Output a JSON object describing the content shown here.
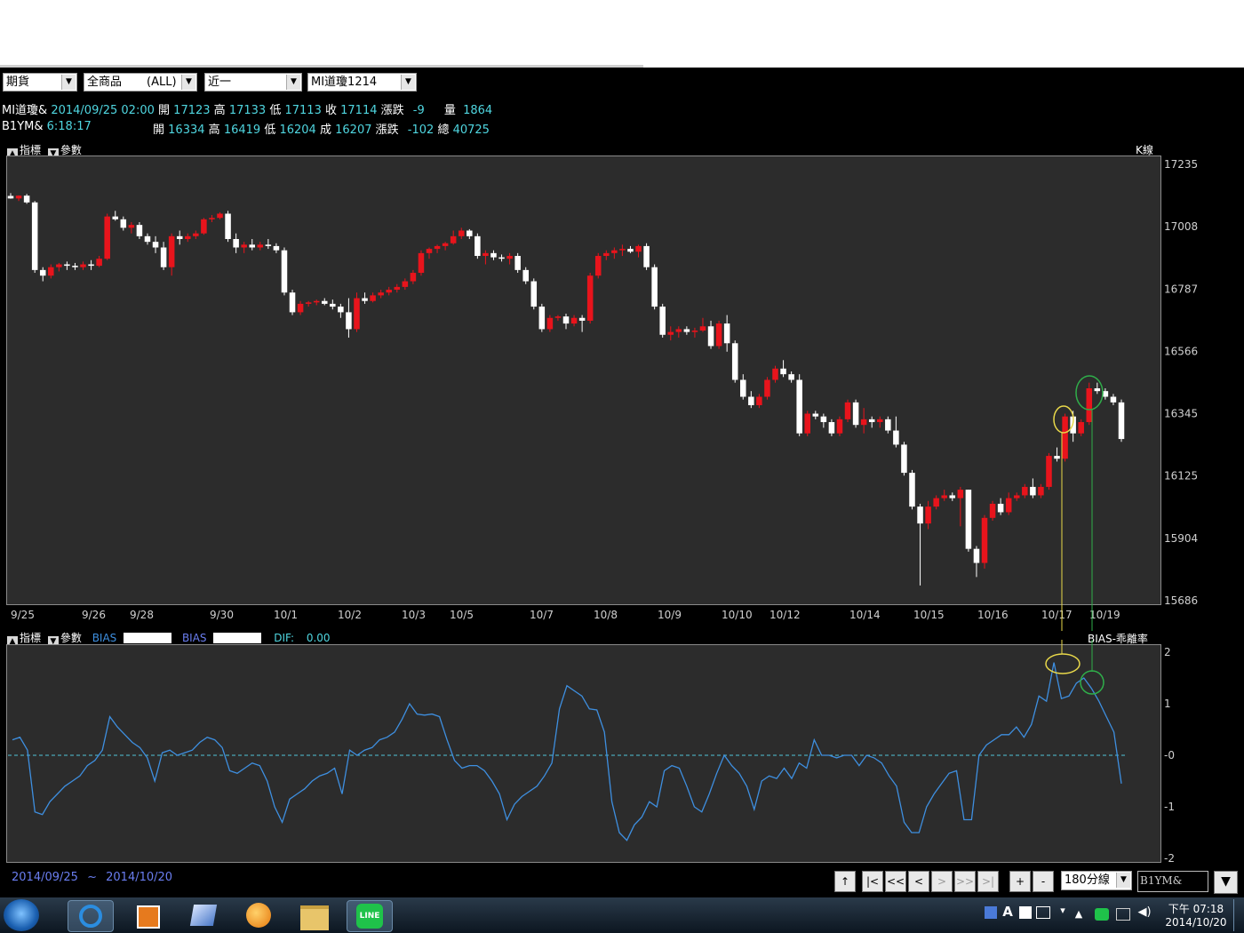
{
  "toolbar": {
    "market": "期貨",
    "products": "全商品",
    "products_filter": "(ALL)",
    "period": "近一",
    "symbol": "MI道瓊1214"
  },
  "quote1": {
    "name": "MI道瓊&",
    "datetime": "2014/09/25 02:00",
    "open_label": "開",
    "open": "17123",
    "high_label": "高",
    "high": "17133",
    "low_label": "低",
    "low": "17113",
    "close_label": "收",
    "close": "17114",
    "chg_label": "漲跌",
    "chg": "-9",
    "vol_label": "量",
    "vol": "1864"
  },
  "quote2": {
    "name": "B1YM&",
    "time": "6:18:17",
    "open_label": "開",
    "open": "16334",
    "high_label": "高",
    "high": "16419",
    "low_label": "低",
    "low": "16204",
    "last_label": "成",
    "last": "16207",
    "chg_label": "漲跌",
    "chg": "-102",
    "total_label": "總",
    "total": "40725"
  },
  "indicator_bar": {
    "indicator_label": "指標",
    "param_label": "參數",
    "main_label": "K線"
  },
  "lower_bar": {
    "indicator_label": "指標",
    "param_label": "參數",
    "bias1": "BIAS",
    "bias2": "BIAS",
    "dif_label": "DIF:",
    "dif_value": "0.00",
    "right_label": "BIAS-乖離率"
  },
  "date_range": {
    "from": "2014/09/25",
    "sep": "~",
    "to": "2014/10/20"
  },
  "nav": {
    "up": "↑",
    "first": "|<",
    "prev_fast": "<<",
    "prev": "<",
    "next": ">",
    "next_fast": ">>",
    "last": ">|",
    "zoom_in": "+",
    "zoom_out": "-",
    "interval": "180分線",
    "code": "B1YM&"
  },
  "clock": {
    "time": "下午 07:18",
    "date": "2014/10/20"
  },
  "chart_data": [
    {
      "type": "candlestick",
      "ylim": [
        15686,
        17235
      ],
      "y_ticks": [
        "17235",
        "17008",
        "16787",
        "16566",
        "16345",
        "16125",
        "15904",
        "15686"
      ],
      "x_labels": [
        "9/25",
        "9/26",
        "9/28",
        "9/30",
        "10/1",
        "10/2",
        "10/3",
        "10/5",
        "10/7",
        "10/8",
        "10/9",
        "10/10",
        "10/12",
        "10/14",
        "10/15",
        "10/16",
        "10/17",
        "10/19"
      ],
      "colors": {
        "up": "#e8141c",
        "down": "#ffffff"
      },
      "ohlc": [
        [
          17123,
          17133,
          17113,
          17114
        ],
        [
          17114,
          17125,
          17105,
          17124
        ],
        [
          17124,
          17130,
          17095,
          17100
        ],
        [
          17100,
          17105,
          16850,
          16860
        ],
        [
          16860,
          16870,
          16820,
          16840
        ],
        [
          16840,
          16880,
          16830,
          16870
        ],
        [
          16870,
          16885,
          16855,
          16880
        ],
        [
          16880,
          16890,
          16860,
          16875
        ],
        [
          16875,
          16885,
          16860,
          16870
        ],
        [
          16870,
          16890,
          16860,
          16880
        ],
        [
          16880,
          16895,
          16860,
          16875
        ],
        [
          16875,
          16910,
          16870,
          16900
        ],
        [
          16900,
          17060,
          16895,
          17050
        ],
        [
          17050,
          17070,
          17035,
          17040
        ],
        [
          17040,
          17050,
          17000,
          17010
        ],
        [
          17010,
          17030,
          16990,
          17020
        ],
        [
          17020,
          17030,
          16970,
          16980
        ],
        [
          16980,
          16990,
          16950,
          16960
        ],
        [
          16960,
          16980,
          16920,
          16940
        ],
        [
          16940,
          16960,
          16860,
          16870
        ],
        [
          16870,
          16990,
          16840,
          16980
        ],
        [
          16980,
          17000,
          16950,
          16970
        ],
        [
          16970,
          16990,
          16960,
          16980
        ],
        [
          16980,
          17000,
          16970,
          16990
        ],
        [
          16990,
          17045,
          16985,
          17040
        ],
        [
          17040,
          17055,
          17030,
          17045
        ],
        [
          17045,
          17065,
          17040,
          17060
        ],
        [
          17060,
          17070,
          16960,
          16970
        ],
        [
          16970,
          16990,
          16920,
          16940
        ],
        [
          16940,
          16960,
          16920,
          16950
        ],
        [
          16950,
          16970,
          16930,
          16940
        ],
        [
          16940,
          16960,
          16930,
          16950
        ],
        [
          16950,
          16970,
          16935,
          16945
        ],
        [
          16945,
          16955,
          16920,
          16930
        ],
        [
          16930,
          16940,
          16770,
          16780
        ],
        [
          16780,
          16790,
          16700,
          16710
        ],
        [
          16710,
          16750,
          16700,
          16740
        ],
        [
          16740,
          16750,
          16730,
          16745
        ],
        [
          16745,
          16755,
          16735,
          16750
        ],
        [
          16750,
          16760,
          16735,
          16740
        ],
        [
          16740,
          16755,
          16720,
          16730
        ],
        [
          16730,
          16740,
          16690,
          16710
        ],
        [
          16710,
          16760,
          16620,
          16650
        ],
        [
          16650,
          16780,
          16640,
          16760
        ],
        [
          16760,
          16780,
          16740,
          16750
        ],
        [
          16750,
          16780,
          16745,
          16770
        ],
        [
          16770,
          16790,
          16760,
          16780
        ],
        [
          16780,
          16800,
          16770,
          16790
        ],
        [
          16790,
          16810,
          16780,
          16800
        ],
        [
          16800,
          16830,
          16790,
          16820
        ],
        [
          16820,
          16860,
          16810,
          16850
        ],
        [
          16850,
          16930,
          16840,
          16920
        ],
        [
          16920,
          16940,
          16900,
          16935
        ],
        [
          16935,
          16950,
          16920,
          16945
        ],
        [
          16945,
          16960,
          16930,
          16955
        ],
        [
          16955,
          17000,
          16950,
          16980
        ],
        [
          16980,
          17010,
          16970,
          17000
        ],
        [
          17000,
          17005,
          16970,
          16980
        ],
        [
          16980,
          16990,
          16900,
          16910
        ],
        [
          16910,
          16930,
          16880,
          16920
        ],
        [
          16920,
          16930,
          16895,
          16905
        ],
        [
          16905,
          16915,
          16890,
          16900
        ],
        [
          16900,
          16920,
          16880,
          16910
        ],
        [
          16910,
          16920,
          16850,
          16860
        ],
        [
          16860,
          16870,
          16810,
          16820
        ],
        [
          16820,
          16830,
          16720,
          16730
        ],
        [
          16730,
          16740,
          16640,
          16650
        ],
        [
          16650,
          16700,
          16640,
          16690
        ],
        [
          16690,
          16700,
          16680,
          16695
        ],
        [
          16695,
          16705,
          16650,
          16670
        ],
        [
          16670,
          16700,
          16660,
          16690
        ],
        [
          16690,
          16700,
          16640,
          16680
        ],
        [
          16680,
          16850,
          16670,
          16840
        ],
        [
          16840,
          16920,
          16830,
          16910
        ],
        [
          16910,
          16930,
          16895,
          16920
        ],
        [
          16920,
          16940,
          16900,
          16930
        ],
        [
          16930,
          16950,
          16910,
          16935
        ],
        [
          16935,
          16945,
          16920,
          16925
        ],
        [
          16925,
          16950,
          16905,
          16945
        ],
        [
          16945,
          16955,
          16860,
          16870
        ],
        [
          16870,
          16880,
          16720,
          16730
        ],
        [
          16730,
          16740,
          16620,
          16630
        ],
        [
          16630,
          16660,
          16610,
          16640
        ],
        [
          16640,
          16660,
          16620,
          16650
        ],
        [
          16650,
          16660,
          16630,
          16640
        ],
        [
          16640,
          16655,
          16620,
          16645
        ],
        [
          16645,
          16690,
          16640,
          16660
        ],
        [
          16660,
          16680,
          16580,
          16590
        ],
        [
          16590,
          16680,
          16580,
          16670
        ],
        [
          16670,
          16700,
          16570,
          16600
        ],
        [
          16600,
          16610,
          16460,
          16470
        ],
        [
          16470,
          16490,
          16400,
          16410
        ],
        [
          16410,
          16430,
          16370,
          16380
        ],
        [
          16380,
          16420,
          16370,
          16410
        ],
        [
          16410,
          16480,
          16400,
          16470
        ],
        [
          16470,
          16520,
          16460,
          16510
        ],
        [
          16510,
          16540,
          16480,
          16490
        ],
        [
          16490,
          16500,
          16460,
          16470
        ],
        [
          16470,
          16490,
          16270,
          16280
        ],
        [
          16280,
          16360,
          16270,
          16350
        ],
        [
          16350,
          16360,
          16330,
          16340
        ],
        [
          16340,
          16350,
          16300,
          16320
        ],
        [
          16320,
          16330,
          16270,
          16280
        ],
        [
          16280,
          16340,
          16270,
          16330
        ],
        [
          16330,
          16400,
          16320,
          16390
        ],
        [
          16390,
          16400,
          16300,
          16310
        ],
        [
          16310,
          16370,
          16280,
          16330
        ],
        [
          16330,
          16340,
          16300,
          16320
        ],
        [
          16320,
          16340,
          16300,
          16330
        ],
        [
          16330,
          16340,
          16280,
          16290
        ],
        [
          16290,
          16340,
          16230,
          16240
        ],
        [
          16240,
          16250,
          16130,
          16140
        ],
        [
          16140,
          16150,
          16010,
          16020
        ],
        [
          16020,
          16030,
          15740,
          15960
        ],
        [
          15960,
          16040,
          15940,
          16020
        ],
        [
          16020,
          16060,
          16010,
          16050
        ],
        [
          16050,
          16080,
          16040,
          16060
        ],
        [
          16060,
          16070,
          16040,
          16050
        ],
        [
          16050,
          16090,
          15950,
          16080
        ],
        [
          16080,
          16080,
          15860,
          15870
        ],
        [
          15870,
          15880,
          15770,
          15820
        ],
        [
          15820,
          15990,
          15800,
          15980
        ],
        [
          15980,
          16040,
          15970,
          16030
        ],
        [
          16030,
          16050,
          15990,
          16000
        ],
        [
          16000,
          16070,
          15990,
          16050
        ],
        [
          16050,
          16070,
          16040,
          16060
        ],
        [
          16060,
          16100,
          16050,
          16090
        ],
        [
          16090,
          16120,
          16050,
          16060
        ],
        [
          16060,
          16100,
          16050,
          16090
        ],
        [
          16090,
          16210,
          16080,
          16200
        ],
        [
          16200,
          16230,
          16180,
          16190
        ],
        [
          16190,
          16350,
          16180,
          16340
        ],
        [
          16340,
          16360,
          16250,
          16280
        ],
        [
          16280,
          16330,
          16270,
          16320
        ],
        [
          16320,
          16460,
          16310,
          16440
        ],
        [
          16440,
          16460,
          16420,
          16430
        ],
        [
          16430,
          16440,
          16400,
          16410
        ],
        [
          16410,
          16420,
          16380,
          16390
        ],
        [
          16390,
          16400,
          16250,
          16260
        ]
      ]
    },
    {
      "type": "line",
      "ylim": [
        -2,
        2
      ],
      "y_ticks": [
        "2",
        "1",
        "-0",
        "-1",
        "-2"
      ],
      "series": [
        {
          "name": "BIAS",
          "color": "#3e8fe0",
          "values": [
            0.3,
            0.35,
            0.1,
            -1.1,
            -1.15,
            -0.9,
            -0.75,
            -0.6,
            -0.5,
            -0.4,
            -0.2,
            -0.1,
            0.1,
            0.75,
            0.55,
            0.4,
            0.25,
            0.15,
            -0.05,
            -0.5,
            0.05,
            0.1,
            0.0,
            0.05,
            0.1,
            0.25,
            0.35,
            0.3,
            0.15,
            -0.3,
            -0.35,
            -0.25,
            -0.15,
            -0.2,
            -0.5,
            -1.0,
            -1.3,
            -0.85,
            -0.75,
            -0.65,
            -0.5,
            -0.4,
            -0.35,
            -0.25,
            -0.75,
            0.1,
            0.0,
            0.1,
            0.15,
            0.3,
            0.35,
            0.45,
            0.7,
            1.0,
            0.8,
            0.78,
            0.8,
            0.75,
            0.3,
            -0.1,
            -0.25,
            -0.2,
            -0.2,
            -0.3,
            -0.5,
            -0.75,
            -1.25,
            -0.95,
            -0.8,
            -0.7,
            -0.6,
            -0.4,
            -0.15,
            0.9,
            1.35,
            1.25,
            1.15,
            0.9,
            0.88,
            0.45,
            -0.9,
            -1.5,
            -1.65,
            -1.35,
            -1.2,
            -0.9,
            -1.0,
            -0.3,
            -0.2,
            -0.25,
            -0.6,
            -1.0,
            -1.1,
            -0.75,
            -0.35,
            0.0,
            -0.2,
            -0.35,
            -0.6,
            -1.05,
            -0.5,
            -0.4,
            -0.45,
            -0.25,
            -0.45,
            -0.15,
            -0.25,
            0.3,
            0.0,
            0.0,
            -0.05,
            0.0,
            0.0,
            -0.2,
            0.0,
            -0.05,
            -0.15,
            -0.4,
            -0.6,
            -1.3,
            -1.5,
            -1.5,
            -1.0,
            -0.75,
            -0.55,
            -0.35,
            -0.3,
            -1.25,
            -1.25,
            0.0,
            0.2,
            0.3,
            0.4,
            0.4,
            0.55,
            0.35,
            0.6,
            1.15,
            1.05,
            1.8,
            1.1,
            1.15,
            1.4,
            1.5,
            1.3,
            1.05,
            0.75,
            0.45,
            -0.55
          ]
        }
      ],
      "zero_line": {
        "value": 0,
        "color": "#4fc3d8"
      }
    }
  ]
}
